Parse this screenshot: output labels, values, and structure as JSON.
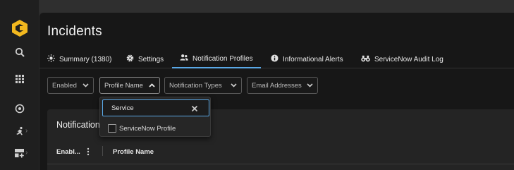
{
  "app": {
    "page_title": "Incidents"
  },
  "colors": {
    "accent": "#5aa8e6",
    "logo": "#f2b81f",
    "background": "#171717",
    "rail": "#1f1f1f"
  },
  "rail": {
    "logo_icon": "hexagon-logo-icon",
    "items": [
      {
        "icon": "search-icon"
      },
      {
        "icon": "grid-icon"
      },
      {
        "icon": "radar-icon"
      },
      {
        "icon": "runner-icon",
        "has_submenu": true
      },
      {
        "icon": "dashboard-add-icon",
        "has_submenu": true
      }
    ]
  },
  "tabs": [
    {
      "label": "Summary (1380)",
      "icon": "sun-icon",
      "active": false
    },
    {
      "label": "Settings",
      "icon": "gear-icon",
      "active": false
    },
    {
      "label": "Notification Profiles",
      "icon": "people-icon",
      "active": true
    },
    {
      "label": "Informational Alerts",
      "icon": "info-icon",
      "active": false
    },
    {
      "label": "ServiceNow Audit Log",
      "icon": "binoculars-icon",
      "active": false
    }
  ],
  "filters": [
    {
      "label": "Enabled",
      "open": false
    },
    {
      "label": "Profile Name",
      "open": true
    },
    {
      "label": "Notification Types",
      "open": false
    },
    {
      "label": "Email Addresses",
      "open": false
    }
  ],
  "dropdown": {
    "search_value": "Service",
    "options": [
      {
        "label": "ServiceNow Profile",
        "checked": false
      }
    ]
  },
  "panel": {
    "title": "Notification Profiles",
    "columns": [
      "Enabl...",
      "Profile Name"
    ]
  }
}
